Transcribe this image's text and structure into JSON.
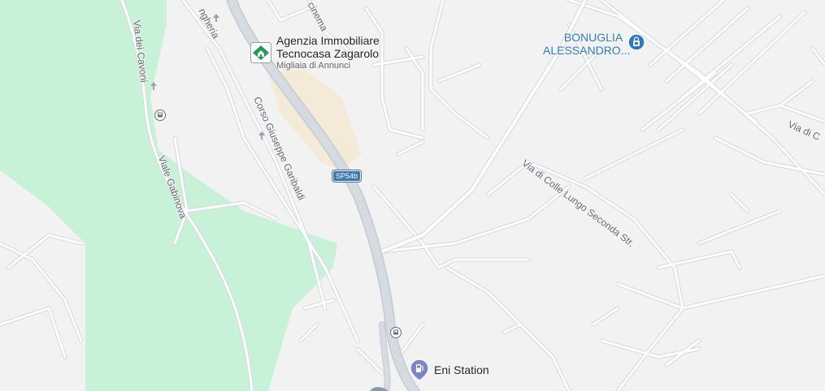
{
  "map": {
    "colors": {
      "background": "#f2f2f3",
      "park": "#c8f2d8",
      "road": "#ffffff",
      "road_casing": "#d3d8de",
      "major_road": "#d6dbe2",
      "built_area": "#f3ead7",
      "poi_blue": "#2979c8",
      "poi_green": "#1f9a4f",
      "fuel_purple": "#7b86c8"
    },
    "streets": {
      "via_dei_cavoni": "Via dei Cavoni",
      "viale_gabinova": "Viale Gabinova",
      "corso_giuseppe_garibaldi": "Corso Giuseppe Garibaldi",
      "via_di_colle_lungo": "Via di Colle Lungo Seconda Str.",
      "ungheria_fragment": "ngheria",
      "cinema_fragment": "cinema",
      "via_di_fragment": "Via di C"
    },
    "route_shield": "SP54b",
    "pois": {
      "tecnocasa": {
        "title_line1": "Agenzia Immobiliare",
        "title_line2": "Tecnocasa Zagarolo",
        "subtitle": "Migliaia di Annunci",
        "icon": "tecnocasa-logo-icon"
      },
      "bonuglia": {
        "title_line1": "BONUGLIA",
        "title_line2": "ALESSANDRO...",
        "icon": "shopping-bag-icon"
      },
      "eni": {
        "title": "Eni Station",
        "icon": "fuel-pump-icon"
      }
    }
  }
}
